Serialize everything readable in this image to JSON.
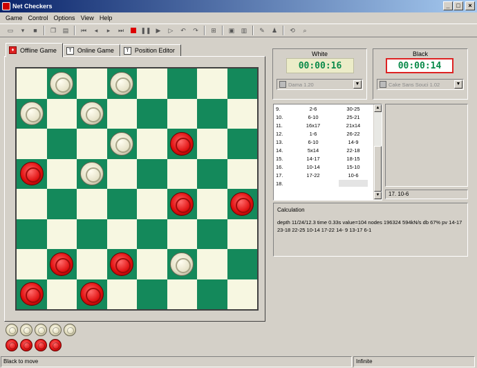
{
  "window": {
    "title": "Net Checkers"
  },
  "menu": [
    "Game",
    "Control",
    "Options",
    "View",
    "Help"
  ],
  "toolbar": {
    "buttons": [
      "new-icon",
      "open-icon",
      "save-icon",
      "copy-icon",
      "paste-icon",
      "first-move-icon",
      "prev-move-icon",
      "next-move-icon",
      "last-move-icon",
      "stop-icon",
      "pause-icon",
      "play-icon",
      "step-icon",
      "undo-icon",
      "redo-icon",
      "flip-board-icon",
      "board-view-icon",
      "layout-icon",
      "settings-icon",
      "engine-icon",
      "book-icon",
      "analyze-icon",
      "search-icon"
    ]
  },
  "tabs": [
    {
      "label": "Offline Game",
      "active": true
    },
    {
      "label": "Online Game",
      "active": false
    },
    {
      "label": "Position Editor",
      "active": false
    }
  ],
  "board": {
    "rows": [
      [
        "",
        "W",
        "",
        "W",
        "",
        "",
        "",
        ""
      ],
      [
        "W",
        "",
        "W",
        "",
        "",
        "",
        "",
        ""
      ],
      [
        "",
        "",
        "",
        "W",
        "",
        "R",
        "",
        ""
      ],
      [
        "R",
        "",
        "W",
        "",
        "",
        "",
        "",
        ""
      ],
      [
        "",
        "",
        "",
        "",
        "",
        "R",
        "",
        "R"
      ],
      [
        "",
        "",
        "",
        "",
        "",
        "",
        "",
        ""
      ],
      [
        "",
        "R",
        "",
        "R",
        "",
        "W",
        "",
        ""
      ],
      [
        "R",
        "",
        "R",
        "",
        "",
        "",
        "",
        ""
      ]
    ]
  },
  "captured": {
    "white": 5,
    "red": 4
  },
  "white_player": {
    "label": "White",
    "clock": "00:00:16",
    "engine": "Dama 1.20"
  },
  "black_player": {
    "label": "Black",
    "clock": "00:00:14",
    "engine": "Cake Sans Souci 1.02"
  },
  "moves": [
    {
      "num": "9.",
      "white": "2-6",
      "black": "30-25"
    },
    {
      "num": "10.",
      "white": "6-10",
      "black": "25-21"
    },
    {
      "num": "11.",
      "white": "16x17",
      "black": "21x14"
    },
    {
      "num": "12.",
      "white": "1-6",
      "black": "26-22"
    },
    {
      "num": "13.",
      "white": "6-10",
      "black": "14-9"
    },
    {
      "num": "14.",
      "white": "5x14",
      "black": "22-18"
    },
    {
      "num": "15.",
      "white": "14-17",
      "black": "18-15"
    },
    {
      "num": "16.",
      "white": "10-14",
      "black": "15-10"
    },
    {
      "num": "17.",
      "white": "17-22",
      "black": "10-6"
    },
    {
      "num": "18.",
      "white": "",
      "black": ""
    }
  ],
  "current_move": "17. 10-6",
  "calculation": {
    "title": "Calculation",
    "text": "depth 11/24/12.3 time 0.33s value=104 nodes 196324 594kN/s db 67% pv 14-17 23-18 22-25 10-14 17-22 14- 9 13-17 6-1"
  },
  "status": {
    "left": "Black to move",
    "right": "Infinite"
  }
}
